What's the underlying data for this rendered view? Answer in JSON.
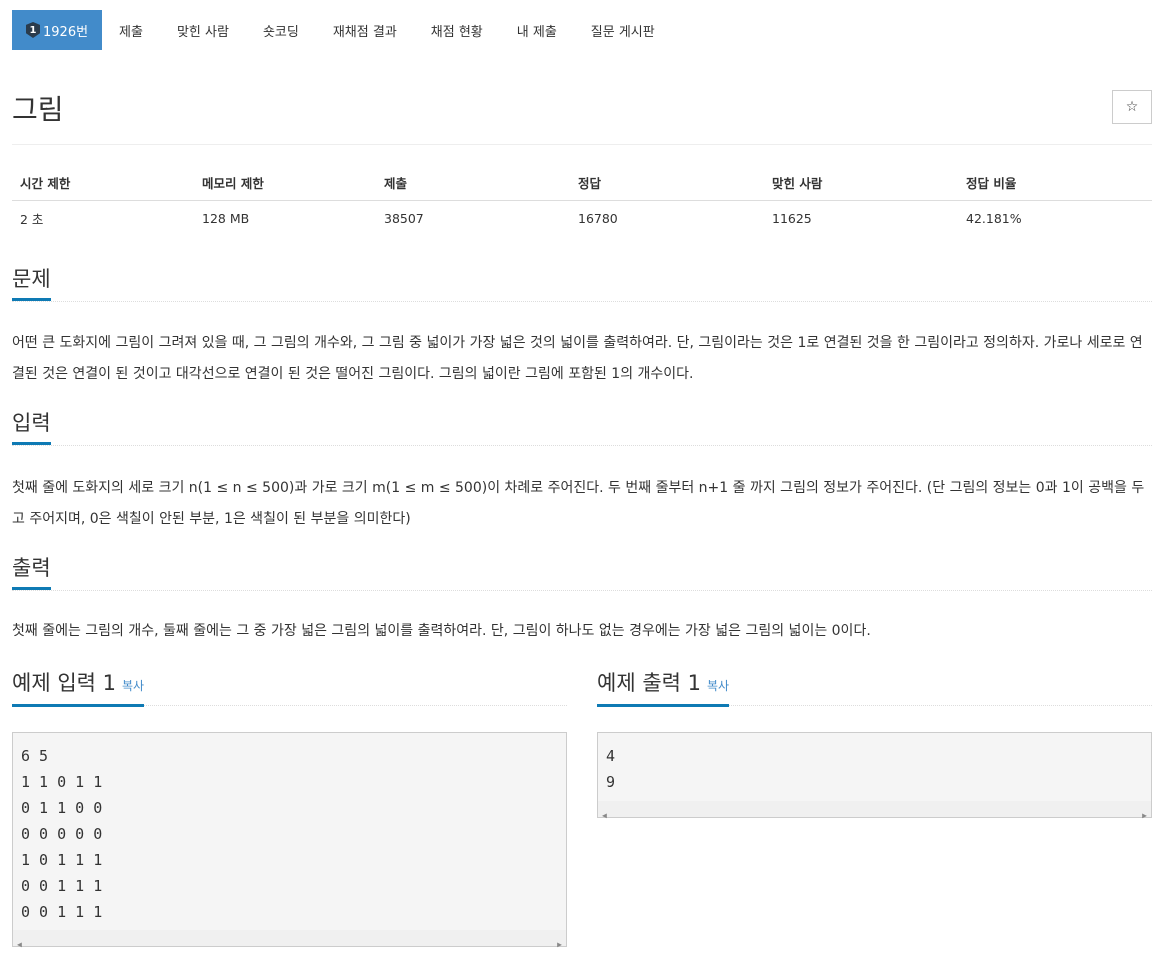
{
  "nav": {
    "problem_badge": "1",
    "items": [
      {
        "label": "1926번",
        "active": true
      },
      {
        "label": "제출"
      },
      {
        "label": "맞힌 사람"
      },
      {
        "label": "숏코딩"
      },
      {
        "label": "재채점 결과"
      },
      {
        "label": "채점 현황"
      },
      {
        "label": "내 제출"
      },
      {
        "label": "질문 게시판"
      }
    ]
  },
  "problem": {
    "title": "그림",
    "star": "☆"
  },
  "info": {
    "headers": [
      "시간 제한",
      "메모리 제한",
      "제출",
      "정답",
      "맞힌 사람",
      "정답 비율"
    ],
    "values": [
      "2 초",
      "128 MB",
      "38507",
      "16780",
      "11625",
      "42.181%"
    ]
  },
  "sections": {
    "description": {
      "heading": "문제",
      "body": "어떤 큰 도화지에 그림이 그려져 있을 때, 그 그림의 개수와, 그 그림 중 넓이가 가장 넓은 것의 넓이를 출력하여라. 단, 그림이라는 것은 1로 연결된 것을 한 그림이라고 정의하자. 가로나 세로로 연결된 것은 연결이 된 것이고 대각선으로 연결이 된 것은 떨어진 그림이다. 그림의 넓이란 그림에 포함된 1의 개수이다."
    },
    "input": {
      "heading": "입력",
      "body": "첫째 줄에 도화지의 세로 크기 n(1 ≤ n ≤ 500)과 가로 크기 m(1 ≤ m ≤ 500)이 차례로 주어진다. 두 번째 줄부터 n+1 줄 까지 그림의 정보가 주어진다. (단 그림의 정보는 0과 1이 공백을 두고 주어지며, 0은 색칠이 안된 부분, 1은 색칠이 된 부분을 의미한다)"
    },
    "output": {
      "heading": "출력",
      "body": "첫째 줄에는 그림의 개수, 둘째 줄에는 그 중 가장 넓은 그림의 넓이를 출력하여라. 단, 그림이 하나도 없는 경우에는 가장 넓은 그림의 넓이는 0이다."
    }
  },
  "samples": {
    "input": {
      "heading": "예제 입력 1",
      "copy_label": "복사",
      "lines": [
        "6 5",
        "1 1 0 1 1",
        "0 1 1 0 0",
        "0 0 0 0 0",
        "1 0 1 1 1",
        "0 0 1 1 1",
        "0 0 1 1 1"
      ]
    },
    "output": {
      "heading": "예제 출력 1",
      "copy_label": "복사",
      "lines": [
        "4",
        "9"
      ]
    }
  },
  "colors": {
    "accent": "#428bca",
    "heading_underline": "#0e7ab4",
    "pre_bg": "#f5f5f5"
  }
}
